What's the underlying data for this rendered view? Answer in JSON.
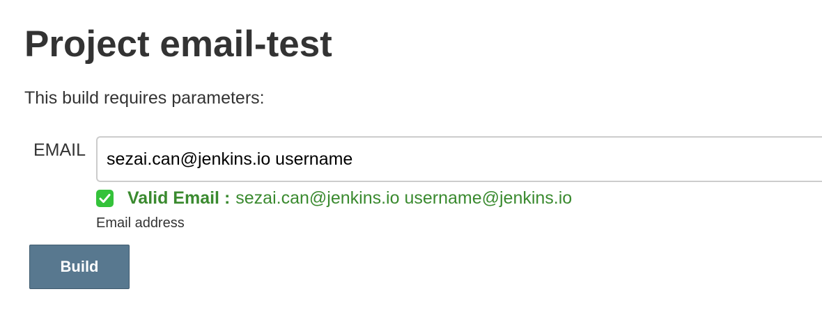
{
  "page": {
    "title": "Project email-test",
    "intro": "This build requires parameters:"
  },
  "parameter": {
    "label": "EMAIL",
    "value": "sezai.can@jenkins.io username",
    "validation_label": "Valid Email :",
    "validation_value": "sezai.can@jenkins.io username@jenkins.io",
    "description": "Email address"
  },
  "actions": {
    "build_label": "Build"
  },
  "icons": {
    "validation": "check-mark-icon"
  },
  "colors": {
    "valid_text": "#3a8a2f",
    "check_icon_bg": "#34c23a",
    "build_button_bg": "#58788f"
  }
}
